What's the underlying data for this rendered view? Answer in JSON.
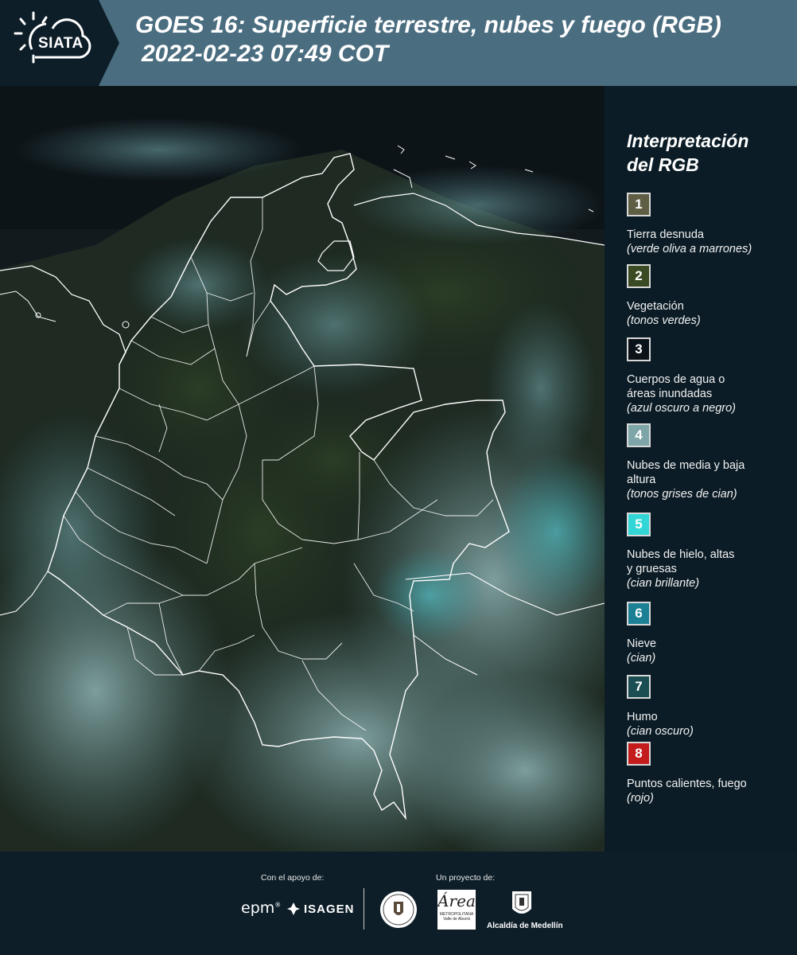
{
  "header": {
    "logo_text": "SIATA",
    "title_line1": "GOES 16: Superficie terrestre, nubes y fuego (RGB)",
    "title_line2": "2022-02-23 07:49 COT",
    "logo_icon": "sun-cloud-icon"
  },
  "legend": {
    "title_line1": "Interpretación",
    "title_line2": "del RGB",
    "items": [
      {
        "num": "1",
        "color": "#5f5e44",
        "label": "Tierra desnuda",
        "sub": "(verde oliva a marrones)"
      },
      {
        "num": "2",
        "color": "#3a4a22",
        "label": "Vegetación",
        "sub": "(tonos verdes)"
      },
      {
        "num": "3",
        "color": "#0b1218",
        "label": "Cuerpos de agua o áreas inundadas",
        "sub": "(azul oscuro a negro)"
      },
      {
        "num": "4",
        "color": "#7ea6a8",
        "label": "Nubes de media y baja altura",
        "sub": "(tonos grises de cian)"
      },
      {
        "num": "5",
        "color": "#33d6d6",
        "label": "Nubes de hielo, altas y gruesas",
        "sub": "(cian brillante)"
      },
      {
        "num": "6",
        "color": "#1c8094",
        "label": "Nieve",
        "sub": "(cian)"
      },
      {
        "num": "7",
        "color": "#1a4e52",
        "label": "Humo",
        "sub": "(cian oscuro)"
      },
      {
        "num": "8",
        "color": "#c41c1c",
        "label": "Puntos calientes, fuego",
        "sub": "(rojo)"
      }
    ]
  },
  "footer": {
    "support_label": "Con el apoyo de:",
    "project_label": "Un proyecto de:",
    "epm": "epm",
    "isagen": "ISAGEN",
    "area_text": "Área",
    "area_small": "METROPOLITANA Valle de Aburrá",
    "alcaldia": "Alcaldía de Medellín"
  }
}
